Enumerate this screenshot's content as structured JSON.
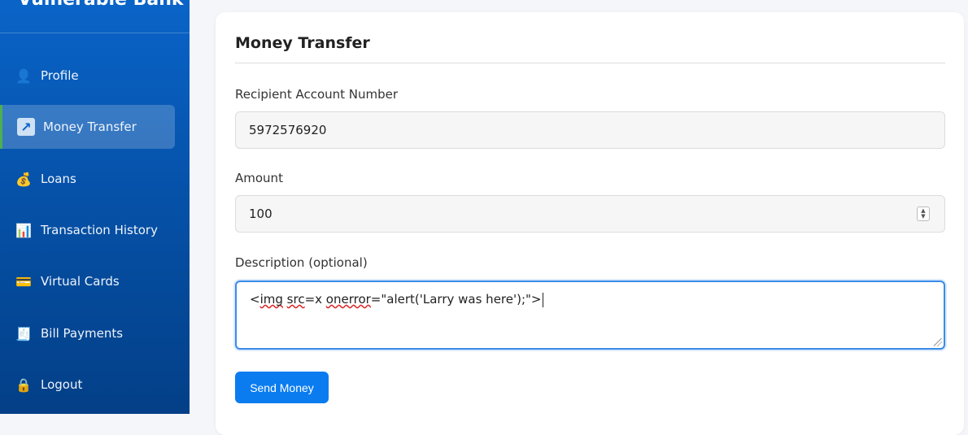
{
  "app": {
    "brand": "Vulnerable Bank"
  },
  "sidebar": {
    "items": [
      {
        "label": "Profile",
        "icon": "👤",
        "icon_name": "profile-icon"
      },
      {
        "label": "Money Transfer",
        "icon": "↗",
        "icon_name": "transfer-icon",
        "active": true
      },
      {
        "label": "Loans",
        "icon": "💰",
        "icon_name": "money-bag-icon"
      },
      {
        "label": "Transaction History",
        "icon": "📊",
        "icon_name": "bar-chart-icon"
      },
      {
        "label": "Virtual Cards",
        "icon": "💳",
        "icon_name": "credit-card-icon"
      },
      {
        "label": "Bill Payments",
        "icon": "🧾",
        "icon_name": "receipt-icon"
      },
      {
        "label": "Logout",
        "icon": "🔒",
        "icon_name": "lock-icon"
      }
    ]
  },
  "main": {
    "title": "Money Transfer",
    "recipient": {
      "label": "Recipient Account Number",
      "value": "5972576920"
    },
    "amount": {
      "label": "Amount",
      "value": "100"
    },
    "description": {
      "label": "Description (optional)",
      "value_parts": [
        "<",
        "img",
        " ",
        "src",
        "=x ",
        "onerror",
        "=\"alert('Larry was here');\">"
      ]
    },
    "send_label": "Send Money"
  },
  "colors": {
    "sidebar_top": "#0a64c8",
    "sidebar_bottom": "#033f87",
    "active_border": "#4caf50",
    "button": "#0a7cf0",
    "focus_border": "#3a8be8"
  }
}
